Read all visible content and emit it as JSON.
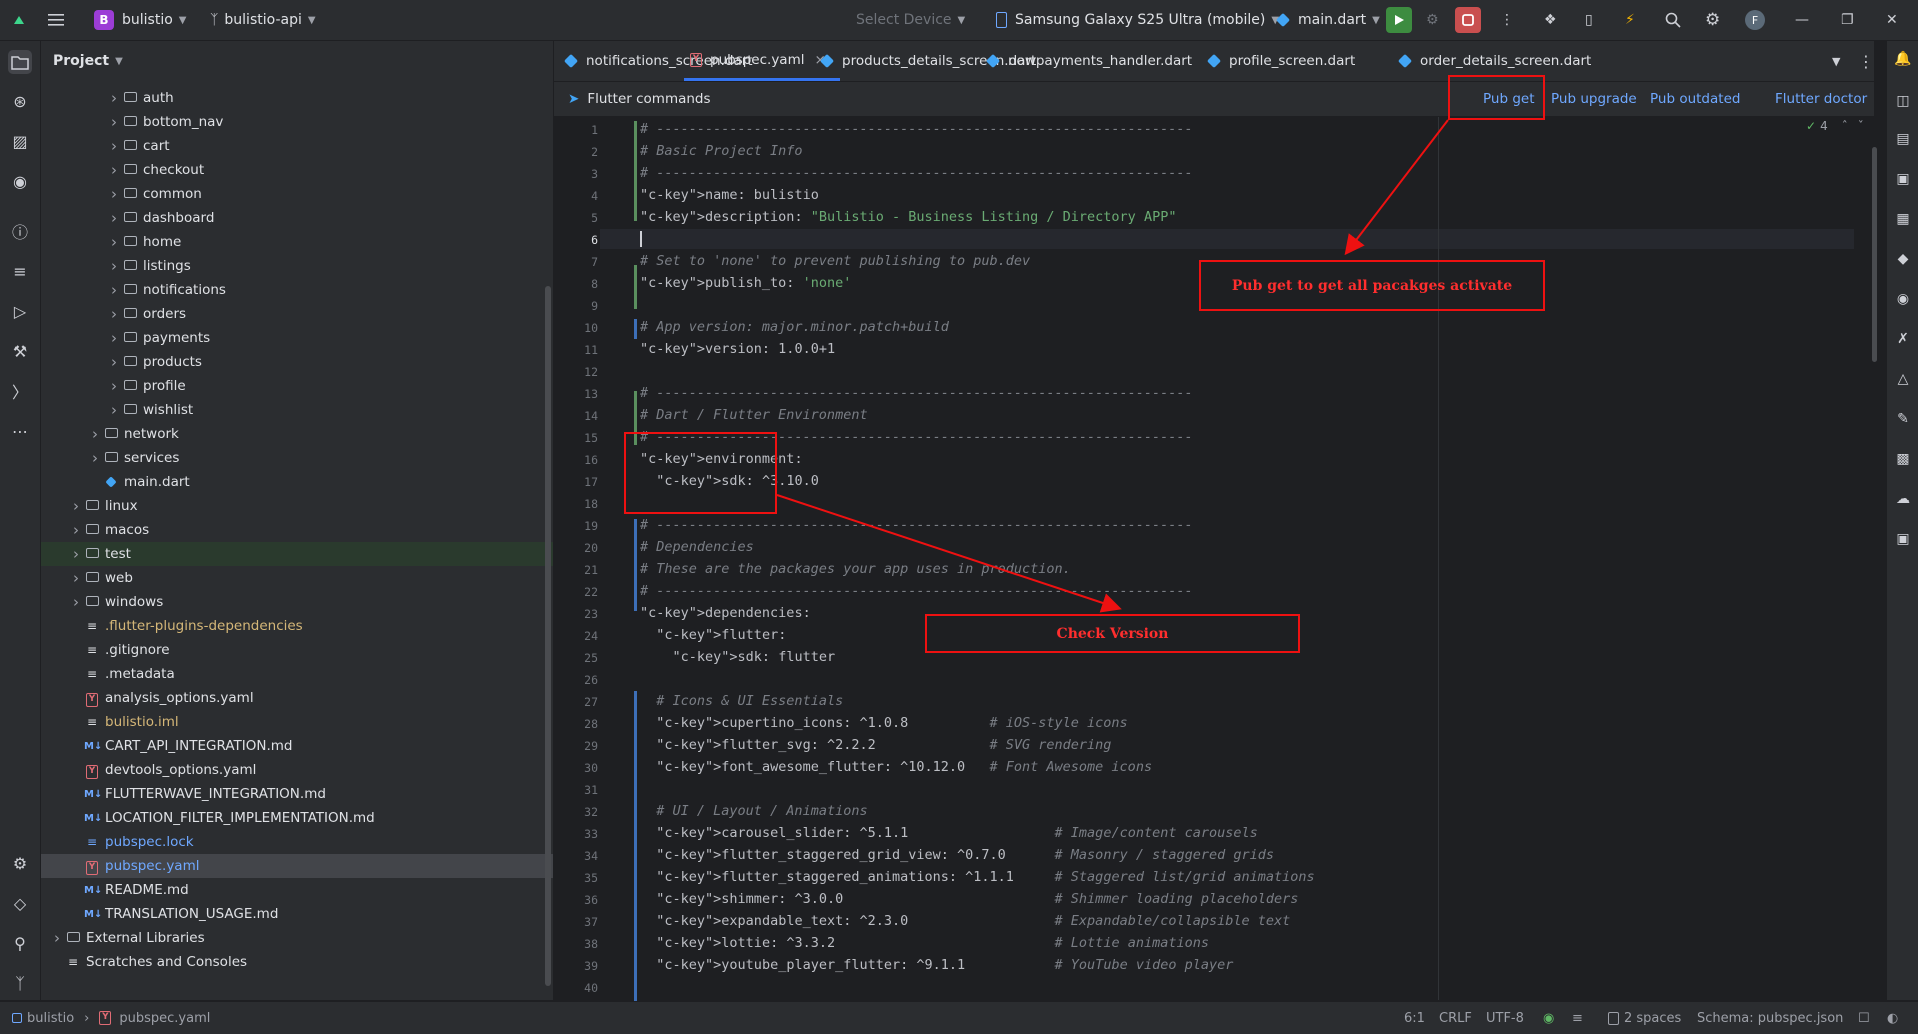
{
  "titlebar": {
    "project_badge": "B",
    "project_name": "bulistio",
    "branch": "bulistio-api",
    "device_select": "Select Device",
    "device": "Samsung Galaxy S25 Ultra (mobile)",
    "run_config": "main.dart",
    "avatar_letter": "F"
  },
  "project_panel": {
    "title": "Project",
    "items": [
      {
        "label": "auth",
        "type": "folder",
        "indent": 3
      },
      {
        "label": "bottom_nav",
        "type": "folder",
        "indent": 3
      },
      {
        "label": "cart",
        "type": "folder",
        "indent": 3
      },
      {
        "label": "checkout",
        "type": "folder",
        "indent": 3
      },
      {
        "label": "common",
        "type": "folder",
        "indent": 3
      },
      {
        "label": "dashboard",
        "type": "folder",
        "indent": 3
      },
      {
        "label": "home",
        "type": "folder",
        "indent": 3
      },
      {
        "label": "listings",
        "type": "folder",
        "indent": 3
      },
      {
        "label": "notifications",
        "type": "folder",
        "indent": 3
      },
      {
        "label": "orders",
        "type": "folder",
        "indent": 3
      },
      {
        "label": "payments",
        "type": "folder",
        "indent": 3
      },
      {
        "label": "products",
        "type": "folder",
        "indent": 3
      },
      {
        "label": "profile",
        "type": "folder",
        "indent": 3
      },
      {
        "label": "wishlist",
        "type": "folder",
        "indent": 3
      },
      {
        "label": "network",
        "type": "folder",
        "indent": 2
      },
      {
        "label": "services",
        "type": "folder",
        "indent": 2
      },
      {
        "label": "main.dart",
        "type": "dart",
        "indent": 2
      },
      {
        "label": "linux",
        "type": "folder",
        "indent": 1
      },
      {
        "label": "macos",
        "type": "folder",
        "indent": 1
      },
      {
        "label": "test",
        "type": "folder",
        "indent": 1
      },
      {
        "label": "web",
        "type": "folder",
        "indent": 1
      },
      {
        "label": "windows",
        "type": "folder",
        "indent": 1
      },
      {
        "label": ".flutter-plugins-dependencies",
        "type": "file-yellow",
        "indent": 1
      },
      {
        "label": ".gitignore",
        "type": "file",
        "indent": 1
      },
      {
        "label": ".metadata",
        "type": "file",
        "indent": 1
      },
      {
        "label": "analysis_options.yaml",
        "type": "yaml",
        "indent": 1
      },
      {
        "label": "bulistio.iml",
        "type": "file-yellow",
        "indent": 1
      },
      {
        "label": "CART_API_INTEGRATION.md",
        "type": "md",
        "indent": 1
      },
      {
        "label": "devtools_options.yaml",
        "type": "yaml",
        "indent": 1
      },
      {
        "label": "FLUTTERWAVE_INTEGRATION.md",
        "type": "md",
        "indent": 1
      },
      {
        "label": "LOCATION_FILTER_IMPLEMENTATION.md",
        "type": "md",
        "indent": 1
      },
      {
        "label": "pubspec.lock",
        "type": "file-blue",
        "indent": 1
      },
      {
        "label": "pubspec.yaml",
        "type": "yaml-blue",
        "indent": 1
      },
      {
        "label": "README.md",
        "type": "md",
        "indent": 1
      },
      {
        "label": "TRANSLATION_USAGE.md",
        "type": "md",
        "indent": 1
      },
      {
        "label": "External Libraries",
        "type": "library",
        "indent": 0
      },
      {
        "label": "Scratches and Consoles",
        "type": "scratch",
        "indent": 0
      }
    ]
  },
  "tabs": [
    {
      "label": "notifications_screen.dart",
      "type": "dart"
    },
    {
      "label": "pubspec.yaml",
      "type": "yaml",
      "active": true
    },
    {
      "label": "products_details_screen.dart",
      "type": "dart"
    },
    {
      "label": "nowpayments_handler.dart",
      "type": "dart"
    },
    {
      "label": "profile_screen.dart",
      "type": "dart"
    },
    {
      "label": "order_details_screen.dart",
      "type": "dart"
    }
  ],
  "flutter_commands": {
    "title": "Flutter commands",
    "pub_get": "Pub get",
    "pub_upgrade": "Pub upgrade",
    "pub_outdated": "Pub outdated",
    "flutter_doctor": "Flutter doctor",
    "problems_count": "4"
  },
  "code_lines": [
    "# ------------------------------------------------------------------",
    "# Basic Project Info",
    "# ------------------------------------------------------------------",
    "name: bulistio",
    "description: \"Bulistio - Business Listing / Directory APP\"",
    "",
    "# Set to 'none' to prevent publishing to pub.dev",
    "publish_to: 'none'",
    "",
    "# App version: major.minor.patch+build",
    "version: 1.0.0+1",
    "",
    "# ------------------------------------------------------------------",
    "# Dart / Flutter Environment",
    "# ------------------------------------------------------------------",
    "environment:",
    "  sdk: ^3.10.0",
    "",
    "# ------------------------------------------------------------------",
    "# Dependencies",
    "# These are the packages your app uses in production.",
    "# ------------------------------------------------------------------",
    "dependencies:",
    "  flutter:",
    "    sdk: flutter",
    "",
    "  # Icons & UI Essentials",
    "  cupertino_icons: ^1.0.8          # iOS-style icons",
    "  flutter_svg: ^2.2.2              # SVG rendering",
    "  font_awesome_flutter: ^10.12.0   # Font Awesome icons",
    "",
    "  # UI / Layout / Animations",
    "  carousel_slider: ^5.1.1                  # Image/content carousels",
    "  flutter_staggered_grid_view: ^0.7.0      # Masonry / staggered grids",
    "  flutter_staggered_animations: ^1.1.1     # Staggered list/grid animations",
    "  shimmer: ^3.0.0                          # Shimmer loading placeholders",
    "  expandable_text: ^2.3.0                  # Expandable/collapsible text",
    "  lottie: ^3.3.2                           # Lottie animations",
    "  youtube_player_flutter: ^9.1.1           # YouTube video player",
    ""
  ],
  "annotations": {
    "pub_get_note": "Pub get to get all pacakges activate",
    "check_version_note": "Check Version"
  },
  "statusbar": {
    "project": "bulistio",
    "file": "pubspec.yaml",
    "position": "6:1",
    "line_sep": "CRLF",
    "encoding": "UTF-8",
    "indent": "2 spaces",
    "schema": "Schema: pubspec.json"
  }
}
